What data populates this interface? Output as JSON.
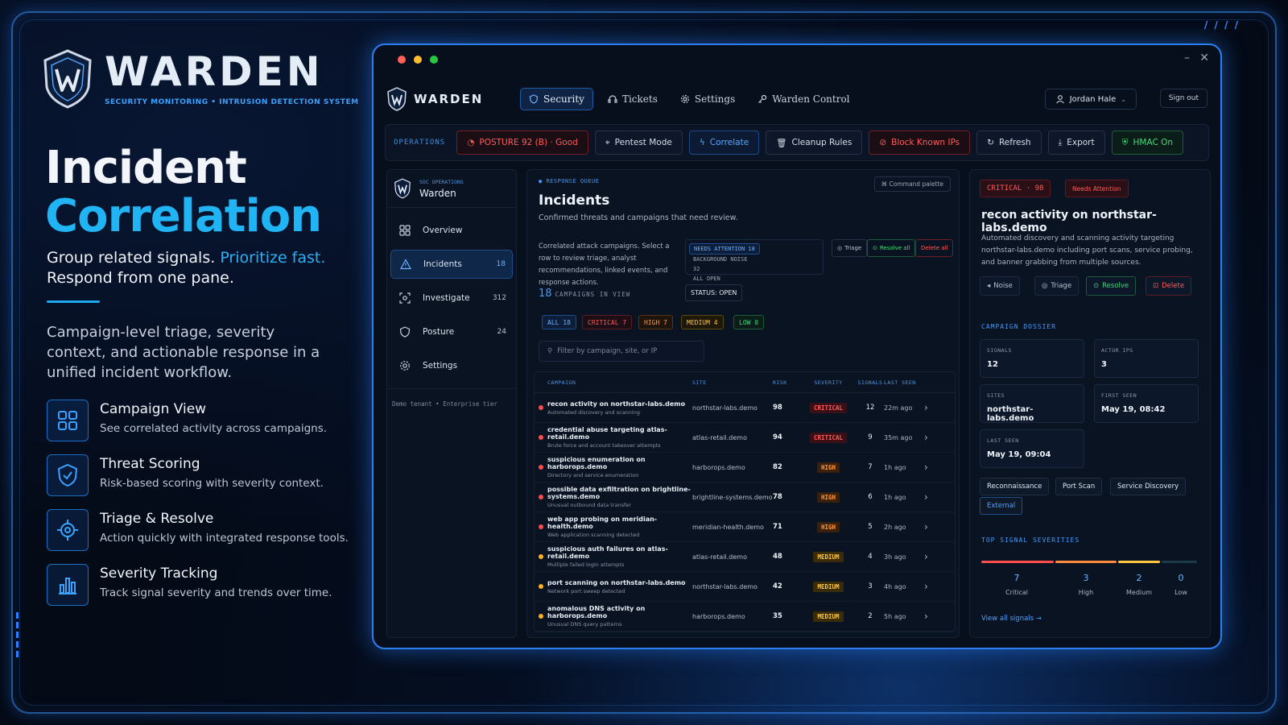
{
  "brand": {
    "name": "WARDEN",
    "subtitle": "SECURITY MONITORING • INTRUSION DETECTION SYSTEM"
  },
  "hero": {
    "line1": "Incident",
    "line2": "Correlation",
    "tagline_a": "Group related signals. ",
    "tagline_b": "Prioritize fast.",
    "tagline_c": "Respond from one pane.",
    "description": "Campaign-level triage, severity context, and actionable response in a unified incident workflow."
  },
  "features": [
    {
      "icon": "grid-icon",
      "title": "Campaign View",
      "desc": "See correlated activity across campaigns."
    },
    {
      "icon": "shield-check-icon",
      "title": "Threat Scoring",
      "desc": "Risk-based scoring with severity context."
    },
    {
      "icon": "crosshair-icon",
      "title": "Triage & Resolve",
      "desc": "Action quickly with integrated response tools."
    },
    {
      "icon": "bar-chart-icon",
      "title": "Severity Tracking",
      "desc": "Track signal severity and trends over time."
    }
  ],
  "window": {
    "minimize": "–",
    "close": "✕"
  },
  "nav": {
    "logo": "WARDEN",
    "tabs": [
      "Security",
      "Tickets",
      "Settings",
      "Warden Control"
    ],
    "user": "Jordan Hale",
    "signout": "Sign out"
  },
  "ops": {
    "label": "OPERATIONS",
    "posture": "POSTURE  92 (B) · Good",
    "pentest": "Pentest Mode",
    "correlate": "Correlate",
    "cleanup": "Cleanup Rules",
    "block": "Block Known IPs",
    "refresh": "Refresh",
    "export": "Export",
    "hmac": "HMAC On"
  },
  "sidebar": {
    "kicker": "SOC OPERATIONS",
    "name": "Warden",
    "items": [
      {
        "label": "Overview",
        "count": ""
      },
      {
        "label": "Incidents",
        "count": "18"
      },
      {
        "label": "Investigate",
        "count": "312"
      },
      {
        "label": "Posture",
        "count": "24"
      },
      {
        "label": "Settings",
        "count": ""
      }
    ],
    "tenant": "Demo tenant • Enterprise tier"
  },
  "main": {
    "kicker": "RESPONSE QUEUE",
    "command": "Command palette",
    "title": "Incidents",
    "subtitle": "Confirmed threats and campaigns that need review.",
    "desc": "Correlated attack campaigns. Select a row to review triage, analyst recommendations, linked events, and response actions.",
    "filter_attention": "NEEDS ATTENTION  18",
    "filter_noise": "BACKGROUND NOISE",
    "filter_noise_count": "32",
    "filter_all": "ALL OPEN",
    "triage": "Triage",
    "resolve_all": "Resolve all",
    "delete_all": "Delete all",
    "campaigns_count": "18",
    "campaigns_label": "CAMPAIGNS IN VIEW",
    "status": "STATUS: OPEN",
    "sev": {
      "all": "ALL  18",
      "critical": "CRITICAL  7",
      "high": "HIGH  7",
      "medium": "MEDIUM  4",
      "low": "LOW  0"
    },
    "search_placeholder": "Filter by campaign, site, or IP",
    "headers": {
      "campaign": "CAMPAIGN",
      "site": "SITE",
      "risk": "RISK",
      "severity": "SEVERITY",
      "signals": "SIGNALS",
      "last": "LAST SEEN"
    },
    "rows": [
      {
        "title": "recon activity on northstar-labs.demo",
        "sub": "Automated discovery and scanning",
        "site": "northstar-labs.demo",
        "risk": "98",
        "severity": "CRITICAL",
        "signals": "12",
        "last": "22m ago",
        "dot": "#ff4d4d"
      },
      {
        "title": "credential abuse targeting atlas-retail.demo",
        "sub": "Brute force and account takeover attempts",
        "site": "atlas-retail.demo",
        "risk": "94",
        "severity": "CRITICAL",
        "signals": "9",
        "last": "35m ago",
        "dot": "#ff4d4d"
      },
      {
        "title": "suspicious enumeration on harborops.demo",
        "sub": "Directory and service enumeration",
        "site": "harborops.demo",
        "risk": "82",
        "severity": "HIGH",
        "signals": "7",
        "last": "1h ago",
        "dot": "#ff4d4d"
      },
      {
        "title": "possible data exfiltration on brightline-systems.demo",
        "sub": "Unusual outbound data transfer",
        "site": "brightline-systems.demo",
        "risk": "78",
        "severity": "HIGH",
        "signals": "6",
        "last": "1h ago",
        "dot": "#ff4d4d"
      },
      {
        "title": "web app probing on meridian-health.demo",
        "sub": "Web application scanning detected",
        "site": "meridian-health.demo",
        "risk": "71",
        "severity": "HIGH",
        "signals": "5",
        "last": "2h ago",
        "dot": "#ff4d4d"
      },
      {
        "title": "suspicious auth failures on atlas-retail.demo",
        "sub": "Multiple failed login attempts",
        "site": "atlas-retail.demo",
        "risk": "48",
        "severity": "MEDIUM",
        "signals": "4",
        "last": "3h ago",
        "dot": "#ffb020"
      },
      {
        "title": "port scanning on northstar-labs.demo",
        "sub": "Network port sweep detected",
        "site": "northstar-labs.demo",
        "risk": "42",
        "severity": "MEDIUM",
        "signals": "3",
        "last": "4h ago",
        "dot": "#ffb020"
      },
      {
        "title": "anomalous DNS activity on harborops.demo",
        "sub": "Unusual DNS query patterns",
        "site": "harborops.demo",
        "risk": "35",
        "severity": "MEDIUM",
        "signals": "2",
        "last": "5h ago",
        "dot": "#ffb020"
      }
    ]
  },
  "detail": {
    "badge": "CRITICAL · 98",
    "attention": "Needs Attention",
    "title": "recon activity on northstar-labs.demo",
    "desc": "Automated discovery and scanning activity targeting northstar-labs.demo including port scans, service probing, and banner grabbing from multiple sources.",
    "noise": "Noise",
    "triage": "Triage",
    "resolve": "Resolve",
    "delete": "Delete",
    "dossier": "CAMPAIGN DOSSIER",
    "cards": {
      "signals_k": "SIGNALS",
      "signals_v": "12",
      "actors_k": "ACTOR IPS",
      "actors_v": "3",
      "sites_k": "SITES",
      "sites_v": "northstar-labs.demo",
      "first_k": "FIRST SEEN",
      "first_v": "May 19, 08:42",
      "last_k": "LAST SEEN",
      "last_v": "May 19, 09:04"
    },
    "tags": [
      "Reconnaissance",
      "Port Scan",
      "Service Discovery",
      "External"
    ],
    "top": "TOP SIGNAL SEVERITIES",
    "counts": [
      {
        "n": "7",
        "l": "Critical"
      },
      {
        "n": "3",
        "l": "High"
      },
      {
        "n": "2",
        "l": "Medium"
      },
      {
        "n": "0",
        "l": "Low"
      }
    ],
    "view_all": "View all signals →"
  }
}
